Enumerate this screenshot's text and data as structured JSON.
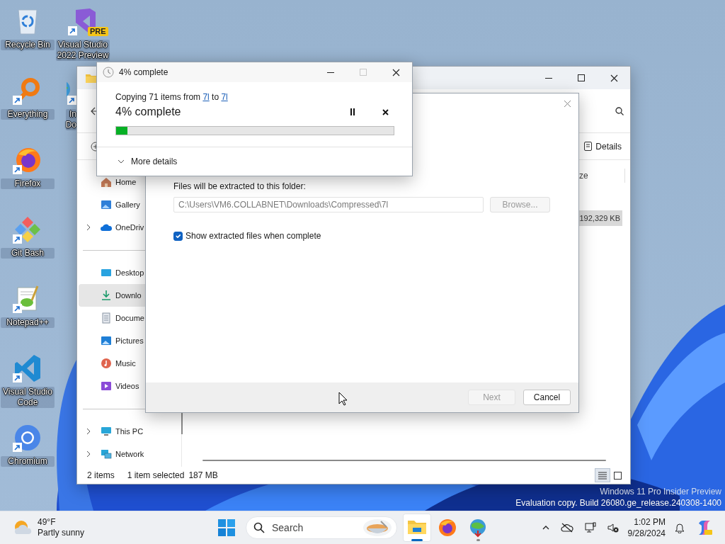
{
  "desktop": {
    "columns": [
      [
        {
          "label": "Recycle Bin",
          "kind": "recycle",
          "shortcut": false
        },
        {
          "label": "Everything",
          "kind": "everything",
          "shortcut": true
        },
        {
          "label": "Firefox",
          "kind": "firefox",
          "shortcut": true
        },
        {
          "label": "Git Bash",
          "kind": "gitbash",
          "shortcut": true
        },
        {
          "label": "Notepad++",
          "kind": "notepad",
          "shortcut": true
        },
        {
          "label": "Visual Studio Code",
          "kind": "vscode",
          "shortcut": true
        },
        {
          "label": "Chromium",
          "kind": "chromium",
          "shortcut": true
        }
      ],
      [
        {
          "label": "Visual Studio 2022 Preview",
          "kind": "vs",
          "shortcut": true,
          "badge": "PRE"
        },
        {
          "label": "In\nDo",
          "kind": "idm",
          "shortcut": true
        }
      ]
    ]
  },
  "explorer": {
    "sidebar": [
      [
        {
          "label": "Home",
          "kind": "home",
          "expandable": false,
          "selected": false
        },
        {
          "label": "Gallery",
          "kind": "gallery",
          "expandable": false,
          "selected": false
        },
        {
          "label": "OneDriv",
          "kind": "cloud",
          "expandable": true,
          "selected": false
        }
      ],
      [
        {
          "label": "Desktop",
          "kind": "desktop",
          "expandable": false,
          "selected": false
        },
        {
          "label": "Downlo",
          "kind": "download",
          "expandable": false,
          "selected": true
        },
        {
          "label": "Docume",
          "kind": "document",
          "expandable": false,
          "selected": false
        },
        {
          "label": "Pictures",
          "kind": "pictures",
          "expandable": false,
          "selected": false
        },
        {
          "label": "Music",
          "kind": "music",
          "expandable": false,
          "selected": false
        },
        {
          "label": "Videos",
          "kind": "videos",
          "expandable": false,
          "selected": false
        }
      ],
      [
        {
          "label": "This PC",
          "kind": "pc",
          "expandable": true,
          "selected": false
        },
        {
          "label": "Network",
          "kind": "network",
          "expandable": true,
          "selected": false
        }
      ]
    ],
    "details_button": "Details",
    "column_header": "ze",
    "selected_size": "192,329 KB",
    "status": {
      "count": "2 items",
      "selection": "1 item selected",
      "size": "187 MB"
    },
    "views": [
      {
        "kind": "details",
        "selected": true
      },
      {
        "kind": "tiles",
        "selected": false
      }
    ]
  },
  "extract_dialog": {
    "folder_label": "Files will be extracted to this folder:",
    "folder_field": {
      "value": "C:\\Users\\VM6.COLLABNET\\Downloads\\Compressed\\7l",
      "disabled": true
    },
    "browse": {
      "label": "Browse...",
      "disabled": true
    },
    "show_files": {
      "label": "Show extracted files when complete",
      "checked": true
    },
    "buttons": [
      {
        "label": "Next",
        "disabled": true
      },
      {
        "label": "Cancel",
        "disabled": false
      }
    ]
  },
  "progress_dialog": {
    "title": "4% complete",
    "maximize_disabled": true,
    "summary": [
      {
        "kind": "text",
        "text": "Copying 71 items from "
      },
      {
        "kind": "link",
        "text": "7l"
      },
      {
        "kind": "text",
        "text": " to "
      },
      {
        "kind": "link",
        "text": "7l"
      }
    ],
    "heading": "4% complete",
    "level": 0.04,
    "more_details": "More details"
  },
  "watermark": [
    "Windows 11 Pro Insider Preview",
    "Evaluation copy. Build 26080.ge_release.240308-1400"
  ],
  "taskbar": {
    "weather": {
      "temperature": "49°F",
      "condition": "Partly sunny"
    },
    "search": {
      "placeholder": "Search"
    },
    "apps": [
      {
        "kind": "explorer",
        "running": true,
        "active": true
      },
      {
        "kind": "firefox",
        "running": false,
        "active": false
      },
      {
        "kind": "idm",
        "running": true,
        "active": false
      }
    ],
    "clock": {
      "time": "1:02 PM",
      "date": "9/28/2024"
    }
  }
}
